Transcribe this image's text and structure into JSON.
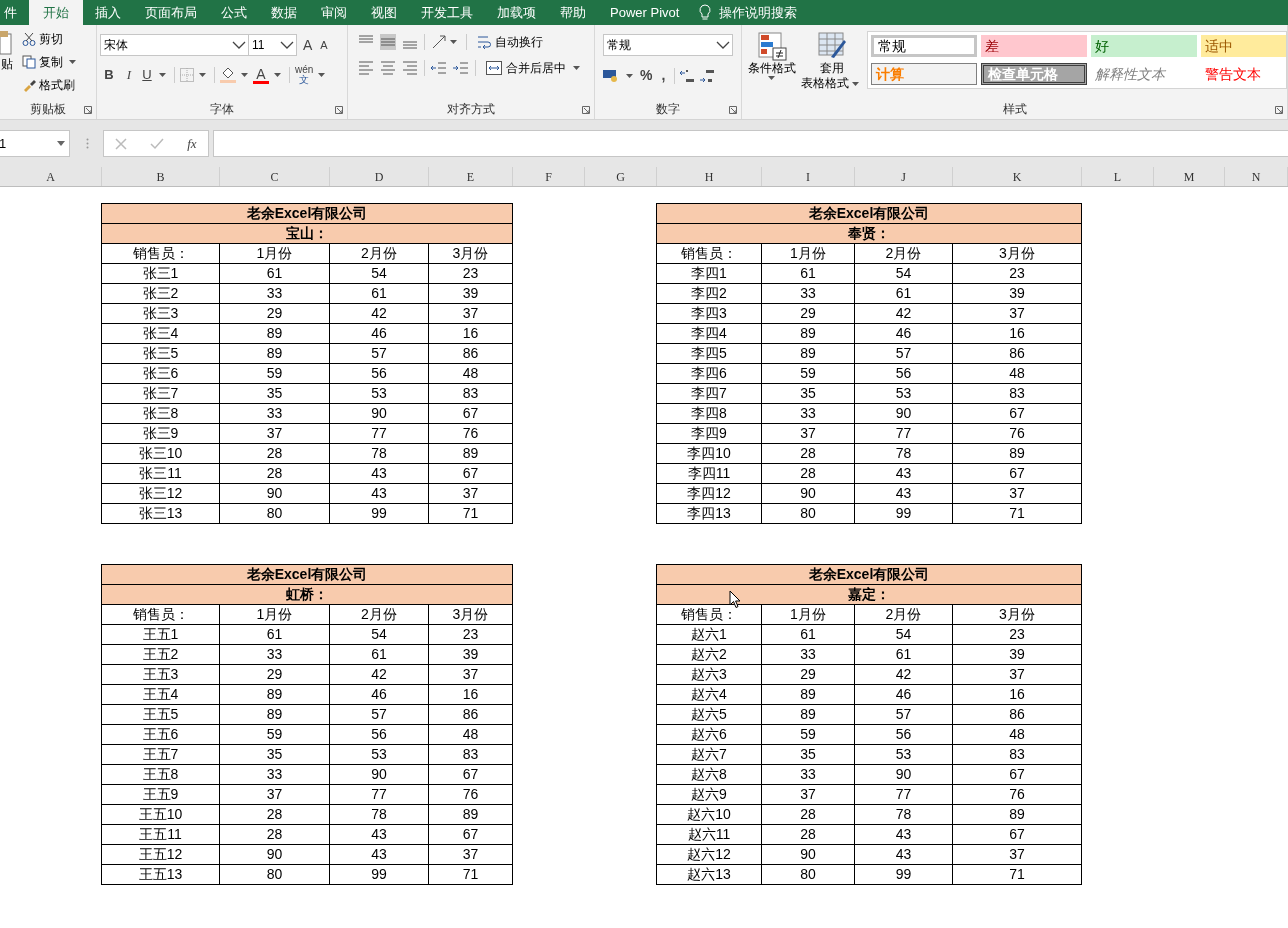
{
  "ribbon_tabs": [
    {
      "label": "件",
      "selected": false
    },
    {
      "label": "开始",
      "selected": true
    },
    {
      "label": "插入",
      "selected": false
    },
    {
      "label": "页面布局",
      "selected": false
    },
    {
      "label": "公式",
      "selected": false
    },
    {
      "label": "数据",
      "selected": false
    },
    {
      "label": "审阅",
      "selected": false
    },
    {
      "label": "视图",
      "selected": false
    },
    {
      "label": "开发工具",
      "selected": false
    },
    {
      "label": "加载项",
      "selected": false
    },
    {
      "label": "帮助",
      "selected": false
    },
    {
      "label": "Power Pivot",
      "selected": false
    }
  ],
  "tell_me": "操作说明搜索",
  "clipboard": {
    "paste": "贴",
    "cut": "剪切",
    "copy": "复制",
    "format_painter": "格式刷",
    "group": "剪贴板"
  },
  "font": {
    "name": "宋体",
    "size": "11",
    "grow": "A",
    "shrink": "A",
    "bold": "B",
    "italic": "I",
    "underline": "U",
    "font_color": "A",
    "phonetic_top": "wén",
    "phonetic_bottom": "文",
    "group": "字体"
  },
  "alignment": {
    "wrap": "自动换行",
    "merge": "合并后居中",
    "group": "对齐方式"
  },
  "number": {
    "format": "常规",
    "percent": "%",
    "comma": ",",
    "group": "数字"
  },
  "styles": {
    "conditional": "条件格式",
    "table_format_1": "套用",
    "table_format_2": "表格格式",
    "group": "样式",
    "cells": [
      {
        "kind": "normal",
        "label": "常规"
      },
      {
        "kind": "bad",
        "label": "差"
      },
      {
        "kind": "good",
        "label": "好"
      },
      {
        "kind": "neutral",
        "label": "适中"
      },
      {
        "kind": "calc",
        "label": "计算"
      },
      {
        "kind": "check",
        "label": "检查单元格"
      },
      {
        "kind": "explanatory",
        "label": "解释性文本"
      },
      {
        "kind": "warning",
        "label": "警告文本"
      }
    ]
  },
  "name_box": "1",
  "formula_fx": "fx",
  "columns": [
    "A",
    "B",
    "C",
    "D",
    "E",
    "F",
    "G",
    "H",
    "I",
    "J",
    "K",
    "L",
    "M",
    "N"
  ],
  "tables": [
    {
      "title": "老余Excel有限公司",
      "region": "宝山：",
      "headers": [
        "销售员：",
        "1月份",
        "2月份",
        "3月份"
      ],
      "rows": [
        [
          "张三1",
          "61",
          "54",
          "23"
        ],
        [
          "张三2",
          "33",
          "61",
          "39"
        ],
        [
          "张三3",
          "29",
          "42",
          "37"
        ],
        [
          "张三4",
          "89",
          "46",
          "16"
        ],
        [
          "张三5",
          "89",
          "57",
          "86"
        ],
        [
          "张三6",
          "59",
          "56",
          "48"
        ],
        [
          "张三7",
          "35",
          "53",
          "83"
        ],
        [
          "张三8",
          "33",
          "90",
          "67"
        ],
        [
          "张三9",
          "37",
          "77",
          "76"
        ],
        [
          "张三10",
          "28",
          "78",
          "89"
        ],
        [
          "张三11",
          "28",
          "43",
          "67"
        ],
        [
          "张三12",
          "90",
          "43",
          "37"
        ],
        [
          "张三13",
          "80",
          "99",
          "71"
        ]
      ]
    },
    {
      "title": "老余Excel有限公司",
      "region": "奉贤：",
      "headers": [
        "销售员：",
        "1月份",
        "2月份",
        "3月份"
      ],
      "rows": [
        [
          "李四1",
          "61",
          "54",
          "23"
        ],
        [
          "李四2",
          "33",
          "61",
          "39"
        ],
        [
          "李四3",
          "29",
          "42",
          "37"
        ],
        [
          "李四4",
          "89",
          "46",
          "16"
        ],
        [
          "李四5",
          "89",
          "57",
          "86"
        ],
        [
          "李四6",
          "59",
          "56",
          "48"
        ],
        [
          "李四7",
          "35",
          "53",
          "83"
        ],
        [
          "李四8",
          "33",
          "90",
          "67"
        ],
        [
          "李四9",
          "37",
          "77",
          "76"
        ],
        [
          "李四10",
          "28",
          "78",
          "89"
        ],
        [
          "李四11",
          "28",
          "43",
          "67"
        ],
        [
          "李四12",
          "90",
          "43",
          "37"
        ],
        [
          "李四13",
          "80",
          "99",
          "71"
        ]
      ]
    },
    {
      "title": "老余Excel有限公司",
      "region": "虹桥：",
      "headers": [
        "销售员：",
        "1月份",
        "2月份",
        "3月份"
      ],
      "rows": [
        [
          "王五1",
          "61",
          "54",
          "23"
        ],
        [
          "王五2",
          "33",
          "61",
          "39"
        ],
        [
          "王五3",
          "29",
          "42",
          "37"
        ],
        [
          "王五4",
          "89",
          "46",
          "16"
        ],
        [
          "王五5",
          "89",
          "57",
          "86"
        ],
        [
          "王五6",
          "59",
          "56",
          "48"
        ],
        [
          "王五7",
          "35",
          "53",
          "83"
        ],
        [
          "王五8",
          "33",
          "90",
          "67"
        ],
        [
          "王五9",
          "37",
          "77",
          "76"
        ],
        [
          "王五10",
          "28",
          "78",
          "89"
        ],
        [
          "王五11",
          "28",
          "43",
          "67"
        ],
        [
          "王五12",
          "90",
          "43",
          "37"
        ],
        [
          "王五13",
          "80",
          "99",
          "71"
        ]
      ]
    },
    {
      "title": "老余Excel有限公司",
      "region": "嘉定：",
      "headers": [
        "销售员：",
        "1月份",
        "2月份",
        "3月份"
      ],
      "rows": [
        [
          "赵六1",
          "61",
          "54",
          "23"
        ],
        [
          "赵六2",
          "33",
          "61",
          "39"
        ],
        [
          "赵六3",
          "29",
          "42",
          "37"
        ],
        [
          "赵六4",
          "89",
          "46",
          "16"
        ],
        [
          "赵六5",
          "89",
          "57",
          "86"
        ],
        [
          "赵六6",
          "59",
          "56",
          "48"
        ],
        [
          "赵六7",
          "35",
          "53",
          "83"
        ],
        [
          "赵六8",
          "33",
          "90",
          "67"
        ],
        [
          "赵六9",
          "37",
          "77",
          "76"
        ],
        [
          "赵六10",
          "28",
          "78",
          "89"
        ],
        [
          "赵六11",
          "28",
          "43",
          "67"
        ],
        [
          "赵六12",
          "90",
          "43",
          "37"
        ],
        [
          "赵六13",
          "80",
          "99",
          "71"
        ]
      ]
    }
  ]
}
